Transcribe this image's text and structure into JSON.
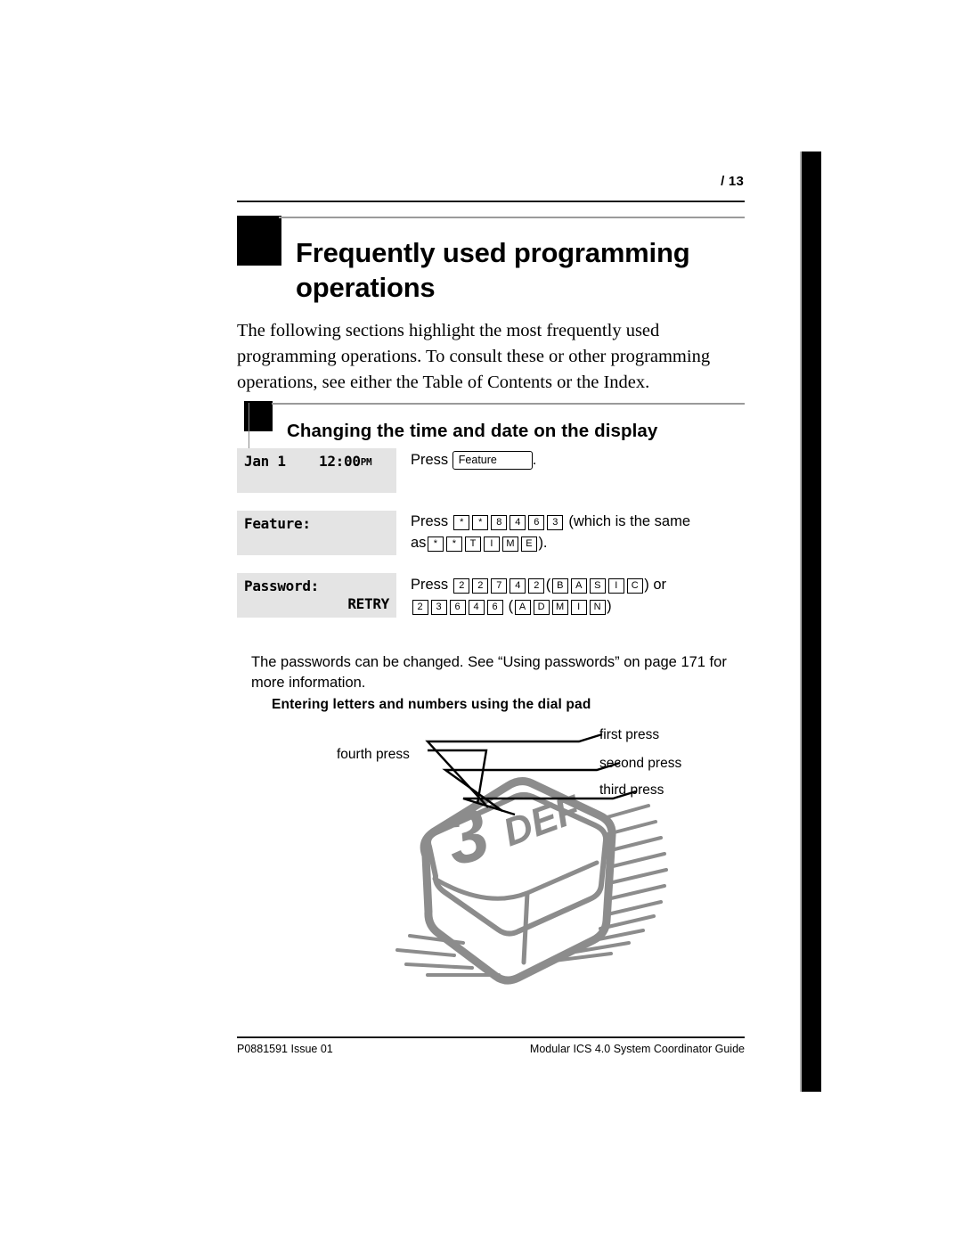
{
  "header": {
    "page_number": "/ 13"
  },
  "chapter": {
    "title": "Frequently used programming operations",
    "intro": "The following sections highlight the most frequently used programming operations. To consult these or other programming operations, see either the Table of Contents or the Index."
  },
  "section": {
    "title": "Changing the time and date on the display"
  },
  "steps": [
    {
      "display_line1_left": "Jan 1",
      "display_line1_right": "12:00",
      "display_line1_suffix": "PM",
      "instruction_prefix": "Press",
      "feature_key_label": "Feature",
      "instruction_suffix": "."
    },
    {
      "display_line1_left": "Feature:",
      "instruction_prefix": "Press",
      "keys": [
        "*",
        "*",
        "8",
        "4",
        "6",
        "3"
      ],
      "paren_note": "(which is the same",
      "as_prefix": "as",
      "alt_keys": [
        "*",
        "*",
        "T",
        "I",
        "M",
        "E"
      ],
      "alt_suffix": ")."
    },
    {
      "display_line1_left": "Password:",
      "display_line2_right": "RETRY",
      "instruction_prefix": "Press",
      "keys": [
        "2",
        "2",
        "7",
        "4",
        "2"
      ],
      "open_paren": "(",
      "letter_keys": [
        "B",
        "A",
        "S",
        "I",
        "C"
      ],
      "close_paren": ")",
      "or_word": "or",
      "keys2": [
        "2",
        "3",
        "6",
        "4",
        "6"
      ],
      "open_paren2": "(",
      "letter_keys2": [
        "A",
        "D",
        "M",
        "I",
        "N"
      ],
      "close_paren2": ")"
    }
  ],
  "note": "The passwords can be changed. See “Using passwords” on page 171 for more information.",
  "figure": {
    "title": "Entering letters and numbers using the dial pad",
    "labels": {
      "first": "first press",
      "second": "second press",
      "third": "third press",
      "fourth": "fourth press"
    },
    "key_digit": "3",
    "key_letters": "DEF",
    "key_color": "#8c8c8c"
  },
  "footer": {
    "left": "P0881591 Issue 01",
    "right": "Modular ICS 4.0 System Coordinator Guide"
  }
}
